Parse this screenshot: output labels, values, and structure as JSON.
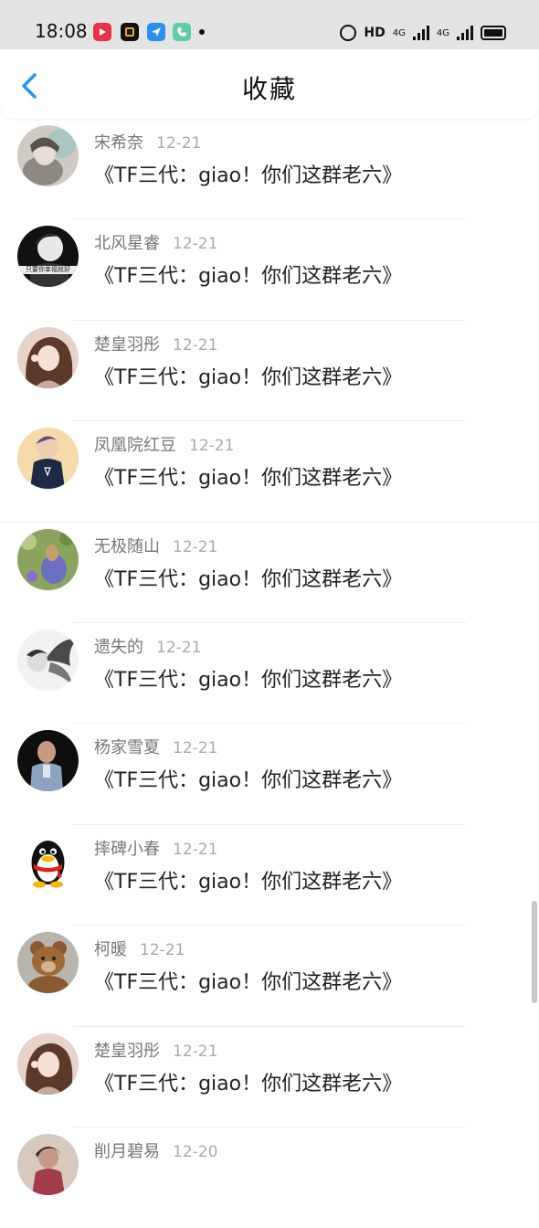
{
  "status_bar": {
    "time": "18:08",
    "hd_label": "HD",
    "net_label_1": "4G",
    "net_label_2": "4G",
    "app_icons": [
      "video-app-icon",
      "o-app-icon",
      "paper-plane-app-icon",
      "phone-app-icon"
    ]
  },
  "header": {
    "title": "收藏",
    "back_icon": "chevron-left-icon",
    "accent_color": "#2196f3"
  },
  "favorites": [
    {
      "name": "宋希奈",
      "date": "12-21",
      "title": "《TF三代：giao！你们这群老六》"
    },
    {
      "name": "北风星睿",
      "date": "12-21",
      "title": "《TF三代：giao！你们这群老六》"
    },
    {
      "name": "楚皇羽彤",
      "date": "12-21",
      "title": "《TF三代：giao！你们这群老六》"
    },
    {
      "name": "凤凰院红豆",
      "date": "12-21",
      "title": "《TF三代：giao！你们这群老六》"
    },
    {
      "name": "无极随山",
      "date": "12-21",
      "title": "《TF三代：giao！你们这群老六》"
    },
    {
      "name": "遗失的",
      "date": "12-21",
      "title": "《TF三代：giao！你们这群老六》"
    },
    {
      "name": "杨家雪夏",
      "date": "12-21",
      "title": "《TF三代：giao！你们这群老六》"
    },
    {
      "name": "摔碑小春",
      "date": "12-21",
      "title": "《TF三代：giao！你们这群老六》"
    },
    {
      "name": "柯暖",
      "date": "12-21",
      "title": "《TF三代：giao！你们这群老六》"
    },
    {
      "name": "楚皇羽彤",
      "date": "12-21",
      "title": "《TF三代：giao！你们这群老六》"
    },
    {
      "name": "削月碧易",
      "date": "12-20",
      "title": ""
    }
  ],
  "avatar_captions": {
    "item_1": "只要你幸福就好"
  }
}
